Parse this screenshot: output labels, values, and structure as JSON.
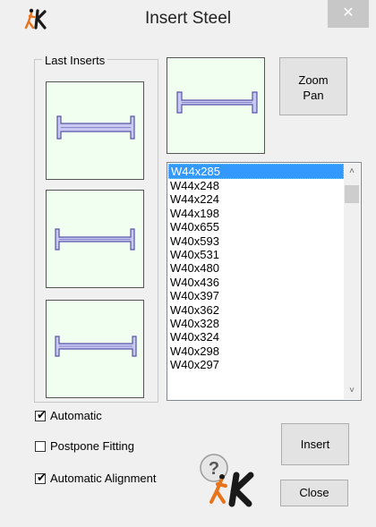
{
  "window": {
    "title": "Insert Steel",
    "close_label": "✕"
  },
  "last_inserts": {
    "label": "Last Inserts"
  },
  "buttons": {
    "zoom_line1": "Zoom",
    "zoom_line2": "Pan",
    "insert": "Insert",
    "close": "Close"
  },
  "list": {
    "items": [
      "W44x285",
      "W44x248",
      "W44x224",
      "W44x198",
      "W40x655",
      "W40x593",
      "W40x531",
      "W40x480",
      "W40x436",
      "W40x397",
      "W40x362",
      "W40x328",
      "W40x324",
      "W40x298",
      "W40x297"
    ],
    "selected": "W44x285"
  },
  "scroll": {
    "up": "˄",
    "down": "˅"
  },
  "options": {
    "automatic": {
      "label": "Automatic",
      "checked": true
    },
    "postpone_fitting": {
      "label": "Postpone Fitting",
      "checked": false
    },
    "automatic_alignment": {
      "label": "Automatic Alignment",
      "checked": true
    }
  },
  "colors": {
    "preview_bg": "#f0fff0",
    "beam_fill": "#c8c8f0",
    "beam_stroke": "#5555aa",
    "logo_orange": "#e8731a",
    "logo_black": "#1a1a1a",
    "selection": "#3399ff"
  },
  "icons": {
    "app": "app-logo-icon",
    "help": "help-logo-icon",
    "close": "close-icon"
  }
}
